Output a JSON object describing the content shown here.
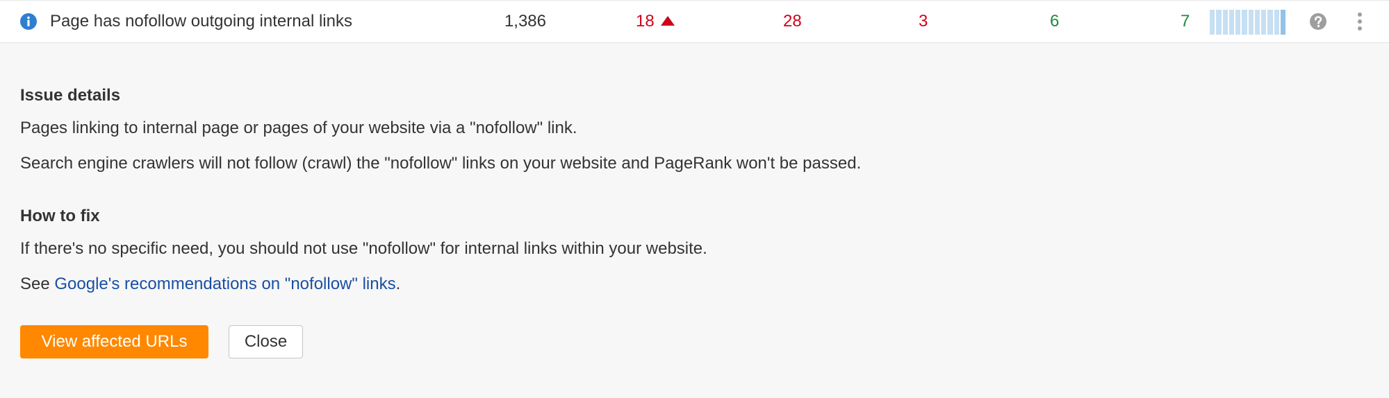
{
  "issue": {
    "title": "Page has nofollow outgoing internal links",
    "icon": "info-icon",
    "total": "1,386",
    "new": "18",
    "new_trend": "up",
    "errors": "28",
    "warnings": "3",
    "notices": "6",
    "fixed": "7",
    "history_bar_count": 12,
    "colors": {
      "info": "#2f7fd0",
      "negative": "#d0021b",
      "positive": "#1e8a3a",
      "bar": "#c6dff3",
      "bar_last": "#92c2e8",
      "help": "#9e9e9e"
    }
  },
  "details": {
    "issue_heading": "Issue details",
    "issue_text_1": "Pages linking to internal page or pages of your website via a \"nofollow\" link.",
    "issue_text_2": "Search engine crawlers will not follow (crawl) the \"nofollow\" links on your website and PageRank won't be passed.",
    "fix_heading": "How to fix",
    "fix_text_1": "If there's no specific need, you should not use \"nofollow\" for internal links within your website.",
    "fix_see_prefix": "See ",
    "fix_link": "Google's recommendations on \"nofollow\" links",
    "fix_see_suffix": "."
  },
  "actions": {
    "view_label": "View affected URLs",
    "view_color": "#ff8800",
    "close_label": "Close"
  }
}
